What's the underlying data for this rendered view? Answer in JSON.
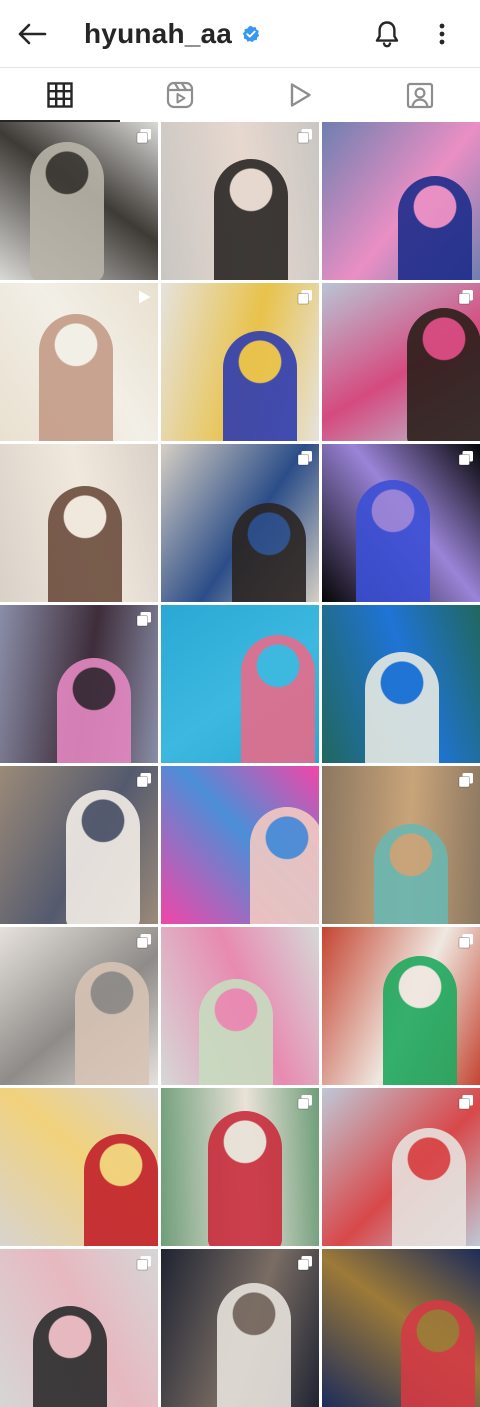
{
  "header": {
    "username": "hyunah_aa",
    "verified": true,
    "icons": [
      "back-arrow-icon",
      "verified-badge-icon",
      "bell-icon",
      "more-vertical-icon"
    ]
  },
  "tabs": [
    {
      "name": "tab-posts",
      "icon": "grid-icon",
      "active": true
    },
    {
      "name": "tab-reels",
      "icon": "reels-icon",
      "active": false
    },
    {
      "name": "tab-videos",
      "icon": "play-icon",
      "active": false
    },
    {
      "name": "tab-tagged",
      "icon": "tagged-person-icon",
      "active": false
    }
  ],
  "grid": {
    "posts": [
      {
        "type": "multiple",
        "colors": [
          "#d9d9d6",
          "#b9b4a9",
          "#3e3a36"
        ]
      },
      {
        "type": "multiple",
        "colors": [
          "#c9c6c2",
          "#2a2624",
          "#e7d8cf"
        ]
      },
      {
        "type": "single",
        "colors": [
          "#6f7fb0",
          "#1d2c8a",
          "#ea8fc4"
        ]
      },
      {
        "type": "reel",
        "colors": [
          "#e9e0cf",
          "#c49b86",
          "#f2efe7"
        ]
      },
      {
        "type": "multiple",
        "colors": [
          "#e6e2dd",
          "#2f3cb0",
          "#e8c24a"
        ]
      },
      {
        "type": "multiple",
        "colors": [
          "#b9c4d4",
          "#2b1e1a",
          "#d54a7f"
        ]
      },
      {
        "type": "none",
        "colors": [
          "#d9d1c8",
          "#6b4c3c",
          "#f1e8dd"
        ]
      },
      {
        "type": "multiple",
        "colors": [
          "#d6cfc4",
          "#2a2422",
          "#2b4d88"
        ]
      },
      {
        "type": "multiple",
        "colors": [
          "#050505",
          "#3b4fd6",
          "#9a84d8"
        ]
      },
      {
        "type": "multiple",
        "colors": [
          "#8a8ea8",
          "#e488c2",
          "#3e2d3a"
        ]
      },
      {
        "type": "none",
        "colors": [
          "#2aa8d4",
          "#e76b8a",
          "#3db9e0"
        ]
      },
      {
        "type": "none",
        "colors": [
          "#21675e",
          "#e6e9e2",
          "#1f74d6"
        ]
      },
      {
        "type": "multiple",
        "colors": [
          "#9b8a78",
          "#f3ede7",
          "#545a6e"
        ]
      },
      {
        "type": "none",
        "colors": [
          "#f246a8",
          "#f3c9c1",
          "#4b8fd8"
        ]
      },
      {
        "type": "multiple",
        "colors": [
          "#8b7760",
          "#69b7b1",
          "#c9a47a"
        ]
      },
      {
        "type": "multiple",
        "colors": [
          "#e6e1dc",
          "#d7c3b5",
          "#8e8b88"
        ]
      },
      {
        "type": "none",
        "colors": [
          "#d6d8d6",
          "#c7dcc0",
          "#e88ab1"
        ]
      },
      {
        "type": "multiple",
        "colors": [
          "#c44532",
          "#1fa95f",
          "#efe8e1"
        ]
      },
      {
        "type": "none",
        "colors": [
          "#d8d3cf",
          "#c21f2a",
          "#f1d27c"
        ]
      },
      {
        "type": "multiple",
        "colors": [
          "#6f9e7a",
          "#c92c3c",
          "#e9e2d8"
        ]
      },
      {
        "type": "multiple",
        "colors": [
          "#bfc8d6",
          "#e7e2de",
          "#d8484a"
        ]
      },
      {
        "type": "multiple",
        "colors": [
          "#d6d6d6",
          "#2a2a2a",
          "#e7b8c0"
        ]
      },
      {
        "type": "multiple",
        "colors": [
          "#1f2432",
          "#e7e2dc",
          "#7a6d64"
        ]
      },
      {
        "type": "none",
        "colors": [
          "#1d2c5a",
          "#d33a44",
          "#9d7a38"
        ]
      }
    ]
  }
}
